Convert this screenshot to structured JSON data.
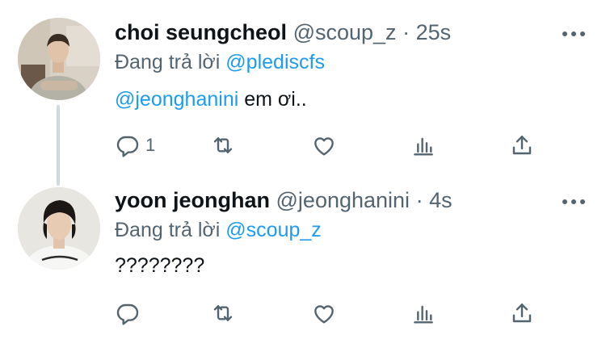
{
  "reply_prefix": "Đang trả lời",
  "colors": {
    "accent": "#1d9bf0",
    "muted": "#536471",
    "text": "#0f1419",
    "thread_line": "#cfd9de"
  },
  "tweets": [
    {
      "display_name": "choi seungcheol",
      "handle": "@scoup_z",
      "separator": "·",
      "time": "25s",
      "replying_to": "@pledis​cfs",
      "body_mention": "@jeonghanini",
      "body_text": " em ơi..",
      "reply_count": "1",
      "icons": [
        "more-icon",
        "reply-icon",
        "retweet-icon",
        "like-icon",
        "views-icon",
        "share-icon"
      ]
    },
    {
      "display_name": "yoon jeonghan",
      "handle": "@jeonghanini",
      "separator": "·",
      "time": "4s",
      "replying_to": "@scoup_z",
      "body_mention": "",
      "body_text": "????????",
      "reply_count": "",
      "icons": [
        "more-icon",
        "reply-icon",
        "retweet-icon",
        "like-icon",
        "views-icon",
        "share-icon"
      ]
    }
  ]
}
